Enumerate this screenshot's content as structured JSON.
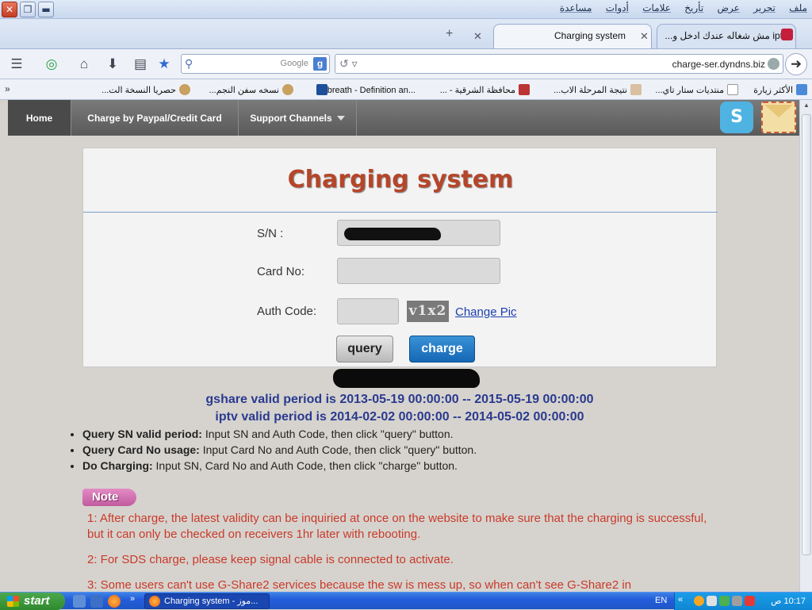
{
  "window": {
    "menu": [
      "ملف",
      "تحرير",
      "عرض",
      "تأريخ",
      "علامات",
      "أدوات",
      "مساعدة"
    ]
  },
  "tabs": {
    "active_title": "Charging system",
    "second_title": "iptv مش شغاله عندك ادخل و..."
  },
  "navbar": {
    "search_provider": "Google",
    "url": "charge-ser.dyndns.biz"
  },
  "bookmarks": [
    "الأكثر زيارة",
    "منتديات ستار تاي...",
    "نتيجة المرحلة الاب...",
    "محافظة الشرقية - ...",
    "breath - Definition an...",
    "نسخه سفن النجم...",
    "حصريا النسخة الت..."
  ],
  "site_nav": {
    "home": "Home",
    "paypal": "Charge by Paypal/Credit Card",
    "support": "Support Channels"
  },
  "panel": {
    "title": "Charging system",
    "sn_label": "S/N :",
    "card_label": "Card No:",
    "auth_label": "Auth Code:",
    "captcha": "v1x2",
    "change_pic": "Change Pic",
    "query": "query",
    "charge": "charge"
  },
  "validity": {
    "gshare": "gshare valid period is 2013-05-19 00:00:00 -- 2015-05-19 00:00:00",
    "iptv": "iptv valid period is 2014-02-02 00:00:00 -- 2014-05-02 00:00:00"
  },
  "howto": [
    {
      "label": "Query SN valid period:",
      "text": " Input SN and Auth Code, then click \"query\" button."
    },
    {
      "label": "Query Card No usage:",
      "text": " Input Card No and Auth Code, then click \"query\" button."
    },
    {
      "label": "Do Charging:",
      "text": " Input SN, Card No and Auth Code, then click \"charge\" button."
    }
  ],
  "note": {
    "badge": "Note",
    "n1": "1: After charge, the latest validity can be inquiried at once on the website to make sure that the charging is successful, but it can only be checked on receivers 1hr later with rebooting.",
    "n2": "2: For SDS charge, please keep signal cable is connected to activate.",
    "n3": "3: Some users can't use G-Share2 services because the sw is mess up, so when can't see G-Share2 in"
  },
  "taskbar": {
    "start": "start",
    "task": "Charging system - موز...",
    "lang": "EN",
    "clock": "10:17 ص"
  },
  "colors": {
    "title_red": "#b5462a",
    "note_red": "#c93a2a",
    "validity_blue": "#2a3a8f",
    "charge_blue": "#1467b5"
  }
}
